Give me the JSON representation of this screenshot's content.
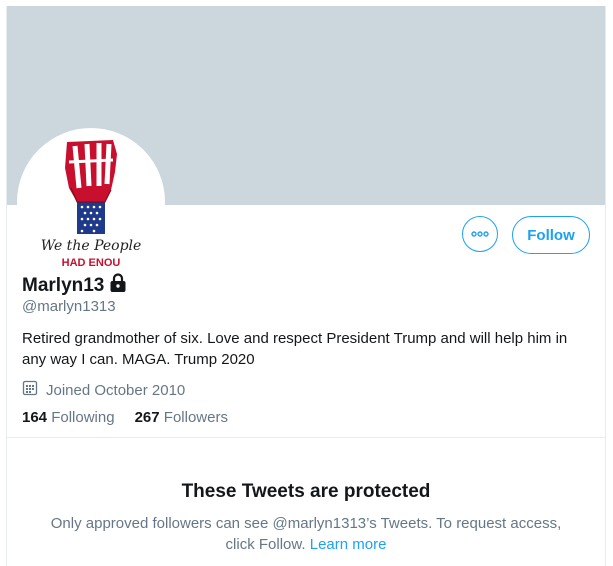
{
  "profile": {
    "display_name": "Marlyn13",
    "handle": "@marlyn1313",
    "bio": "Retired grandmother of six. Love and respect President Trump and will help him in any way I can. MAGA. Trump 2020",
    "joined": "Joined October 2010",
    "avatar_text_1": "We the People",
    "avatar_text_2": "HAD ENOU"
  },
  "actions": {
    "follow_label": "Follow",
    "more_icon": "more-dots-icon"
  },
  "stats": {
    "following_count": "164",
    "following_label": "Following",
    "followers_count": "267",
    "followers_label": "Followers"
  },
  "protected": {
    "title": "These Tweets are protected",
    "body": "Only approved followers can see @marlyn1313’s Tweets. To request access, click Follow.",
    "link": "Learn more"
  },
  "colors": {
    "accent": "#1da1f2",
    "banner": "#ccd6dd",
    "secondary_text": "#657786"
  }
}
